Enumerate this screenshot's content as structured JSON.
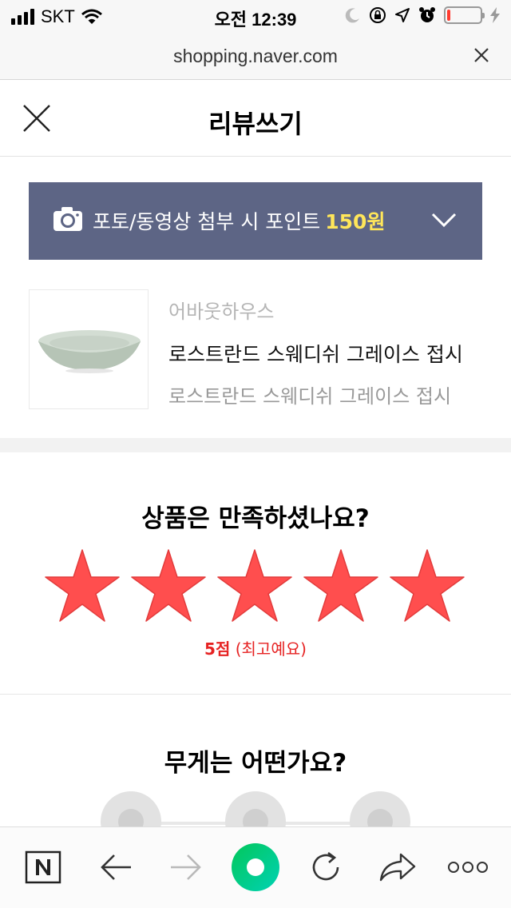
{
  "status_bar": {
    "carrier": "SKT",
    "time": "오전 12:39",
    "battery_level_percent": 10,
    "battery_color": "#ff3b30"
  },
  "browser": {
    "url": "shopping.naver.com"
  },
  "header": {
    "title": "리뷰쓰기"
  },
  "banner": {
    "text": "포토/동영상 첨부 시 포인트",
    "points": "150원",
    "background": "#5d6585",
    "points_color": "#ffe65a"
  },
  "product": {
    "seller": "어바웃하우스",
    "name": "로스트란드 스웨디쉬 그레이스 접시",
    "option": "로스트란드 스웨디쉬 그레이스 접시"
  },
  "rating": {
    "question": "상품은 만족하셨나요?",
    "stars_selected": 5,
    "stars_total": 5,
    "star_color": "#ff4e4e",
    "score_label": "5점",
    "score_desc": "(최고예요)"
  },
  "weight": {
    "question": "무게는 어떤가요?"
  },
  "toolbar": {
    "icons": [
      "naver-home-icon",
      "back-arrow-icon",
      "forward-arrow-icon",
      "green-dot-icon",
      "refresh-icon",
      "share-icon",
      "more-icon"
    ],
    "accent": "#19ce60"
  }
}
